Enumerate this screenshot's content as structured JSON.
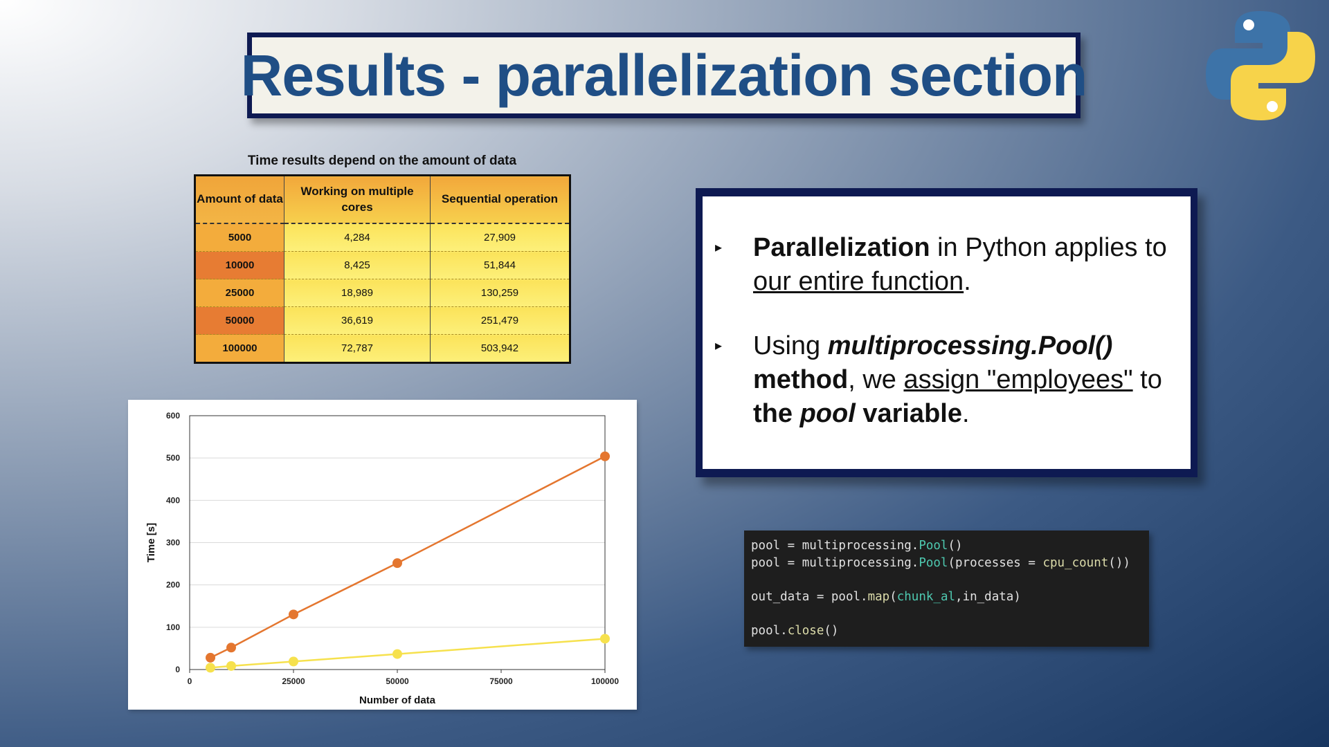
{
  "title": "Results - parallelization section",
  "table": {
    "caption": "Time results depend on the amount of data",
    "headers": [
      "Amount of data",
      "Working on multiple cores",
      "Sequential operation"
    ],
    "rows": [
      [
        "5000",
        "4,284",
        "27,909"
      ],
      [
        "10000",
        "8,425",
        "51,844"
      ],
      [
        "25000",
        "18,989",
        "130,259"
      ],
      [
        "50000",
        "36,619",
        "251,479"
      ],
      [
        "100000",
        "72,787",
        "503,942"
      ]
    ]
  },
  "bullets": {
    "b1": {
      "bold": "Parallelization",
      "rest": " in Python applies to ",
      "underlined": "our entire function",
      "end": "."
    },
    "b2": {
      "pre": "Using ",
      "method": "multiprocessing.Pool()",
      "method_word": " method",
      "mid": ", we ",
      "underlined": "assign \"employees\"",
      "to": " to ",
      "the": "the ",
      "pool": "pool",
      "variable": " variable",
      "end": "."
    }
  },
  "code": {
    "line1": {
      "a": "pool = multiprocessing.",
      "cls": "Pool",
      "b": "()"
    },
    "line2": {
      "a": "pool = multiprocessing.",
      "cls": "Pool",
      "b": "(processes = ",
      "fn": "cpu_count",
      "c": "())"
    },
    "line3": {
      "a": "out_data = pool.",
      "fn": "map",
      "b": "(",
      "var": "chunk_al",
      "c": ",in_data)"
    },
    "line4": {
      "a": "pool.",
      "fn": "close",
      "b": "()"
    }
  },
  "chart_data": {
    "type": "line",
    "xlabel": "Number of data",
    "ylabel": "Time [s]",
    "xlim": [
      0,
      100000
    ],
    "ylim": [
      0,
      600
    ],
    "x_ticks": [
      0,
      25000,
      50000,
      75000,
      100000
    ],
    "y_ticks": [
      0,
      100,
      200,
      300,
      400,
      500,
      600
    ],
    "grid": true,
    "series": [
      {
        "x": [
          5000,
          10000,
          25000,
          50000,
          100000
        ],
        "values": [
          27.909,
          51.844,
          130.259,
          251.479,
          503.942
        ],
        "color": "#e4762f"
      },
      {
        "x": [
          5000,
          10000,
          25000,
          50000,
          100000
        ],
        "values": [
          4.284,
          8.425,
          18.989,
          36.619,
          72.787
        ],
        "color": "#f6e14d"
      }
    ]
  },
  "icons": {
    "logo": "python-logo-icon",
    "bullet": "triangle-bullet-icon"
  },
  "colors": {
    "title_text": "#1f4e85",
    "frame": "#0e1a52",
    "orange": "#e4762f",
    "yellow": "#f6e14d"
  }
}
